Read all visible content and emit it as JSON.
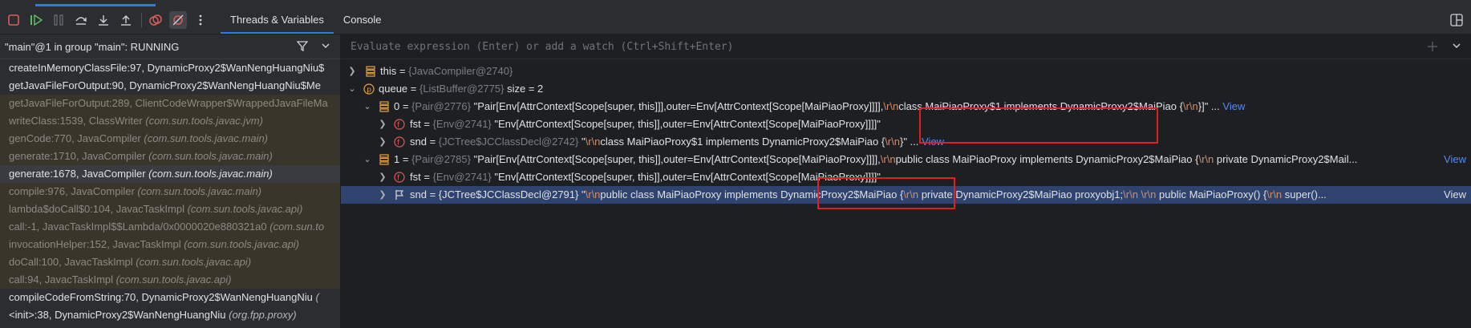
{
  "toolbar": {
    "icons": [
      "stop-icon",
      "resume-icon",
      "pause-icon",
      "step-over-icon",
      "step-into-icon",
      "step-out-icon",
      "view-breakpoints-icon",
      "mute-breakpoints-icon",
      "more-icon"
    ],
    "tabs": [
      {
        "label": "Threads & Variables",
        "active": true
      },
      {
        "label": "Console",
        "active": false
      }
    ]
  },
  "thread_header": {
    "text": "\"main\"@1 in group \"main\": RUNNING"
  },
  "frames": [
    {
      "method": "createInMemoryClassFile:97, DynamicProxy2$WanNengHuangNiu$",
      "pkg": "",
      "kind": "app"
    },
    {
      "method": "getJavaFileForOutput:90, DynamicProxy2$WanNengHuangNiu$Me",
      "pkg": "",
      "kind": "app"
    },
    {
      "method": "getJavaFileForOutput:289, ClientCodeWrapper$WrappedJavaFileMa",
      "pkg": "",
      "kind": "lib"
    },
    {
      "method": "writeClass:1539, ClassWriter ",
      "pkg": "(com.sun.tools.javac.jvm)",
      "kind": "lib"
    },
    {
      "method": "genCode:770, JavaCompiler ",
      "pkg": "(com.sun.tools.javac.main)",
      "kind": "lib"
    },
    {
      "method": "generate:1710, JavaCompiler ",
      "pkg": "(com.sun.tools.javac.main)",
      "kind": "lib"
    },
    {
      "method": "generate:1678, JavaCompiler ",
      "pkg": "(com.sun.tools.javac.main)",
      "kind": "sel"
    },
    {
      "method": "compile:976, JavaCompiler ",
      "pkg": "(com.sun.tools.javac.main)",
      "kind": "lib"
    },
    {
      "method": "lambda$doCall$0:104, JavacTaskImpl ",
      "pkg": "(com.sun.tools.javac.api)",
      "kind": "lib"
    },
    {
      "method": "call:-1, JavacTaskImpl$$Lambda/0x0000020e880321a0 ",
      "pkg": "(com.sun.to",
      "kind": "lib"
    },
    {
      "method": "invocationHelper:152, JavacTaskImpl ",
      "pkg": "(com.sun.tools.javac.api)",
      "kind": "lib"
    },
    {
      "method": "doCall:100, JavacTaskImpl ",
      "pkg": "(com.sun.tools.javac.api)",
      "kind": "lib"
    },
    {
      "method": "call:94, JavacTaskImpl ",
      "pkg": "(com.sun.tools.javac.api)",
      "kind": "lib"
    },
    {
      "method": "compileCodeFromString:70, DynamicProxy2$WanNengHuangNiu ",
      "pkg": "(",
      "kind": "app"
    },
    {
      "method": "<init>:38, DynamicProxy2$WanNengHuangNiu ",
      "pkg": "(org.fpp.proxy)",
      "kind": "app"
    }
  ],
  "evaluate": {
    "placeholder": "Evaluate expression (Enter) or add a watch (Ctrl+Shift+Enter)"
  },
  "variables": {
    "this": {
      "name": "this",
      "type": "{JavaCompiler@2740}"
    },
    "queue": {
      "name": "queue",
      "type": "{ListBuffer@2775}",
      "size": "size = 2"
    },
    "item0": {
      "name": "0",
      "type": "{Pair@2776}",
      "value_a": "\"Pair[Env[AttrContext[Scope[super, this]]],outer=Env[AttrContext[Scope[MaiPiaoProxy]]]],",
      "esc1": "\\r\\n",
      "value_b": "class MaiPiaoProxy$1 implements DynamicProxy2$MaiPiao {",
      "esc2": "\\r\\n",
      "value_c": "}]\" ...",
      "view": "View"
    },
    "item0_fst": {
      "name": "fst",
      "type": "{Env@2741}",
      "value": "\"Env[AttrContext[Scope[super, this]],outer=Env[AttrContext[Scope[MaiPiaoProxy]]]]\""
    },
    "item0_snd": {
      "name": "snd",
      "type": "{JCTree$JCClassDecl@2742}",
      "q": "\"",
      "esc1": "\\r\\n",
      "value_b": "class MaiPiaoProxy$1 implements DynamicProxy2$MaiPiao {",
      "esc2": "\\r\\n",
      "value_c": "}\" ...",
      "view": "View"
    },
    "item1": {
      "name": "1",
      "type": "{Pair@2785}",
      "value_a": "\"Pair[Env[AttrContext[Scope[super, this]],outer=Env[AttrContext[Scope[MaiPiaoProxy]]]],",
      "esc1": "\\r\\n",
      "value_b": "public class MaiPiaoProxy implements DynamicProxy2$MaiPiao {",
      "esc2": "\\r\\n",
      "value_c": "    private DynamicProxy2$Mail...",
      "view": "View"
    },
    "item1_fst": {
      "name": "fst",
      "type": "{Env@2741}",
      "value": "\"Env[AttrContext[Scope[super, this]],outer=Env[AttrContext[Scope[MaiPiaoProxy]]]]\""
    },
    "item1_snd": {
      "name": "snd",
      "type": "{JCTree$JCClassDecl@2791}",
      "value_a": "\"",
      "esc1": "\\r\\n",
      "value_b": "public class MaiPiaoProxy implements DynamicProxy2$MaiPiao {",
      "esc2": "\\r\\n",
      "value_c": "    private DynamicProxy2$MaiPiao proxyobj1;",
      "esc3": "\\r\\n",
      "esc4": "\\r\\n",
      "value_d": "    public MaiPiaoProxy() {",
      "esc5": "\\r\\n",
      "value_e": "        super()...",
      "view": "View"
    }
  },
  "colors": {
    "accent": "#3574f0",
    "highlight_box": "#e02020",
    "selected_row": "#2e436e",
    "library_frame": "#39352b"
  }
}
